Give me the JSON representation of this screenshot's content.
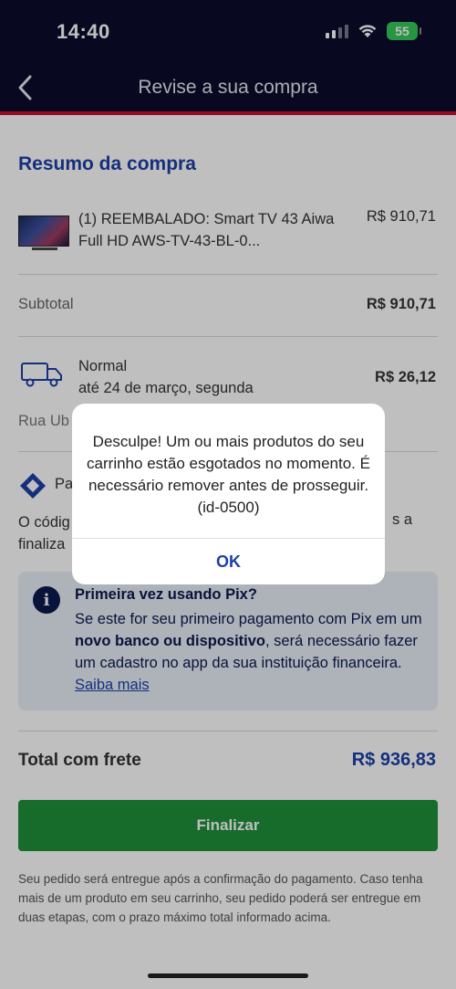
{
  "status_bar": {
    "time": "14:40",
    "battery": "55"
  },
  "header": {
    "title": "Revise a sua compra"
  },
  "summary": {
    "title": "Resumo da compra",
    "product_name": "(1) REEMBALADO: Smart TV 43 Aiwa Full HD AWS-TV-43-BL-0...",
    "product_price": "R$ 910,71",
    "subtotal_label": "Subtotal",
    "subtotal_value": "R$ 910,71"
  },
  "shipping": {
    "name": "Normal",
    "date": "até 24 de março, segunda",
    "price": "R$ 26,12",
    "address": "Rua Ub"
  },
  "payment": {
    "label": "Pa",
    "code_text_left": "O códig",
    "code_text_right": "s a",
    "code_text_line2": "finaliza"
  },
  "pix_info": {
    "title": "Primeira vez usando Pix?",
    "body_before_bold": "Se este for seu primeiro pagamento com Pix em um ",
    "body_bold": "novo banco ou dispositivo",
    "body_after_bold": ", será necessário fazer um cadastro no app da sua instituição financeira. ",
    "link": "Saiba mais"
  },
  "total": {
    "label": "Total com frete",
    "value": "R$ 936,83"
  },
  "finalize_button": "Finalizar",
  "footer_note": "Seu pedido será entregue após a confirmação do pagamento. Caso tenha mais de um produto em seu carrinho, seu pedido poderá ser entregue em duas etapas, com o prazo máximo total informado acima.",
  "dialog": {
    "message": "Desculpe! Um ou mais produtos do seu carrinho estão esgotados no momento. É necessário remover antes de prosseguir. (id-0500)",
    "ok_label": "OK"
  },
  "colors": {
    "header_bg": "#0b0b2d",
    "accent_red": "#c8102e",
    "brand_blue": "#1d3fa8",
    "finalize_green": "#1f8f3a",
    "battery_green": "#34c759"
  },
  "icons": [
    "chevron-left-icon",
    "signal-icon",
    "wifi-icon",
    "battery-icon",
    "truck-icon",
    "pix-icon",
    "info-icon"
  ]
}
